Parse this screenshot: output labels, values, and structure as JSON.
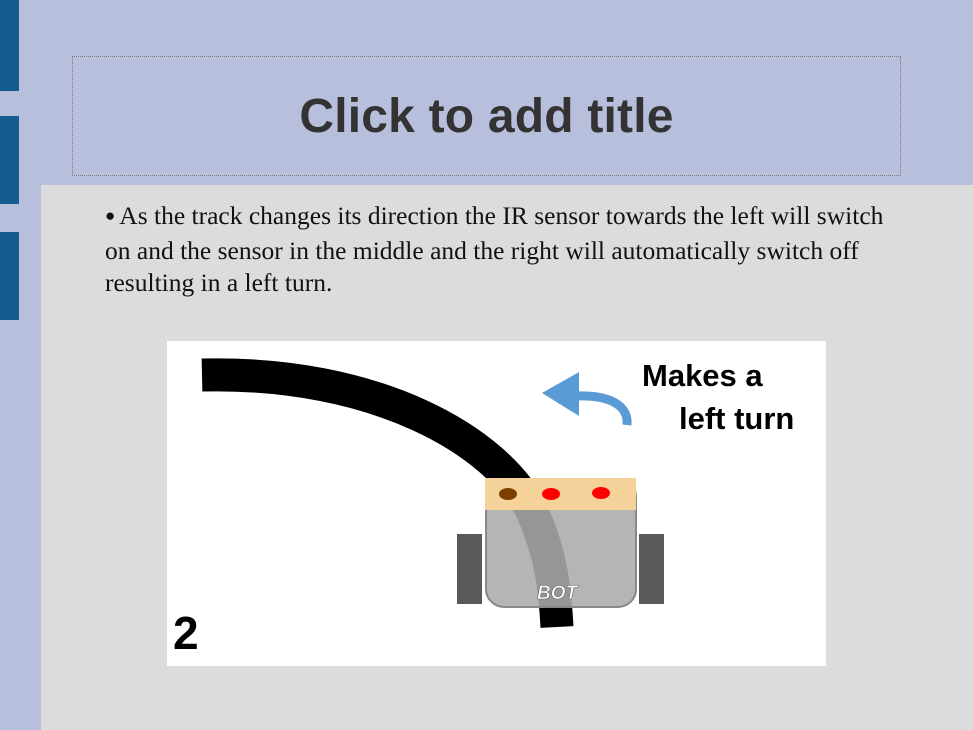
{
  "slide": {
    "title": "Click to add title",
    "bullet_text": "As the track changes its direction the IR sensor towards the left will switch on and the sensor in the middle and the right will automatically switch off resulting in a left turn."
  },
  "figure": {
    "caption_line1": "Makes a",
    "caption_line2": "left turn",
    "step_number": "2",
    "robot_label": "BOT",
    "colors": {
      "track": "#000000",
      "arrow": "#5b9bd5",
      "sensor_bar": "#f5d29a",
      "sensor_on": "#7b3f00",
      "sensor_off": "#ff0000",
      "robot_body": "#ababab",
      "wheels": "#595959"
    }
  }
}
